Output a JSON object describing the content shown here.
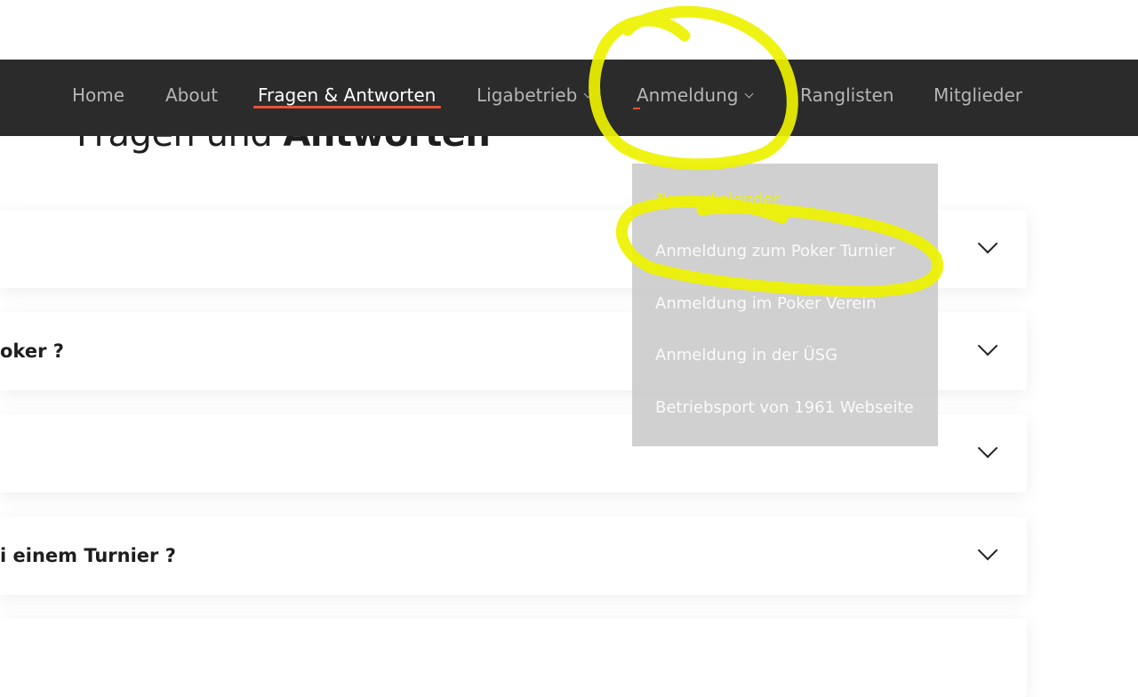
{
  "page": {
    "title_light": "Fragen und ",
    "title_bold": "Antworten"
  },
  "nav": {
    "items": [
      {
        "label": "Home"
      },
      {
        "label": "About"
      },
      {
        "label": "Fragen & Antworten",
        "active": true
      },
      {
        "label": "Ligabetrieb",
        "has_submenu": true
      },
      {
        "label": "Anmeldung",
        "has_submenu": true
      },
      {
        "label": "Ranglisten"
      },
      {
        "label": "Mitglieder"
      }
    ]
  },
  "dropdown": {
    "parent": "Anmeldung",
    "items": [
      {
        "label": "Turnierkalender"
      },
      {
        "label": "Anmeldung zum Poker Turnier"
      },
      {
        "label": "Anmeldung im Poker Verein"
      },
      {
        "label": "Anmeldung in der ÜSG"
      },
      {
        "label": "Betriebsport von 1961 Webseite"
      }
    ]
  },
  "faq": {
    "items": [
      {
        "question": ""
      },
      {
        "question": "oker ?"
      },
      {
        "question": ""
      },
      {
        "question": "i einem Turnier ?"
      }
    ]
  },
  "colors": {
    "nav_bg": "#2b2b2b",
    "nav_text": "#b5b5b5",
    "nav_active_text": "#ffffff",
    "accent": "#e8533a",
    "dropdown_bg": "#c8c8c8",
    "annotation": "#eef200"
  },
  "annotations": {
    "type": "yellow-marker-circle",
    "targets": [
      "nav-item-anmeldung",
      "dropdown-item-anmeldung-zum-poker-turnier"
    ]
  }
}
